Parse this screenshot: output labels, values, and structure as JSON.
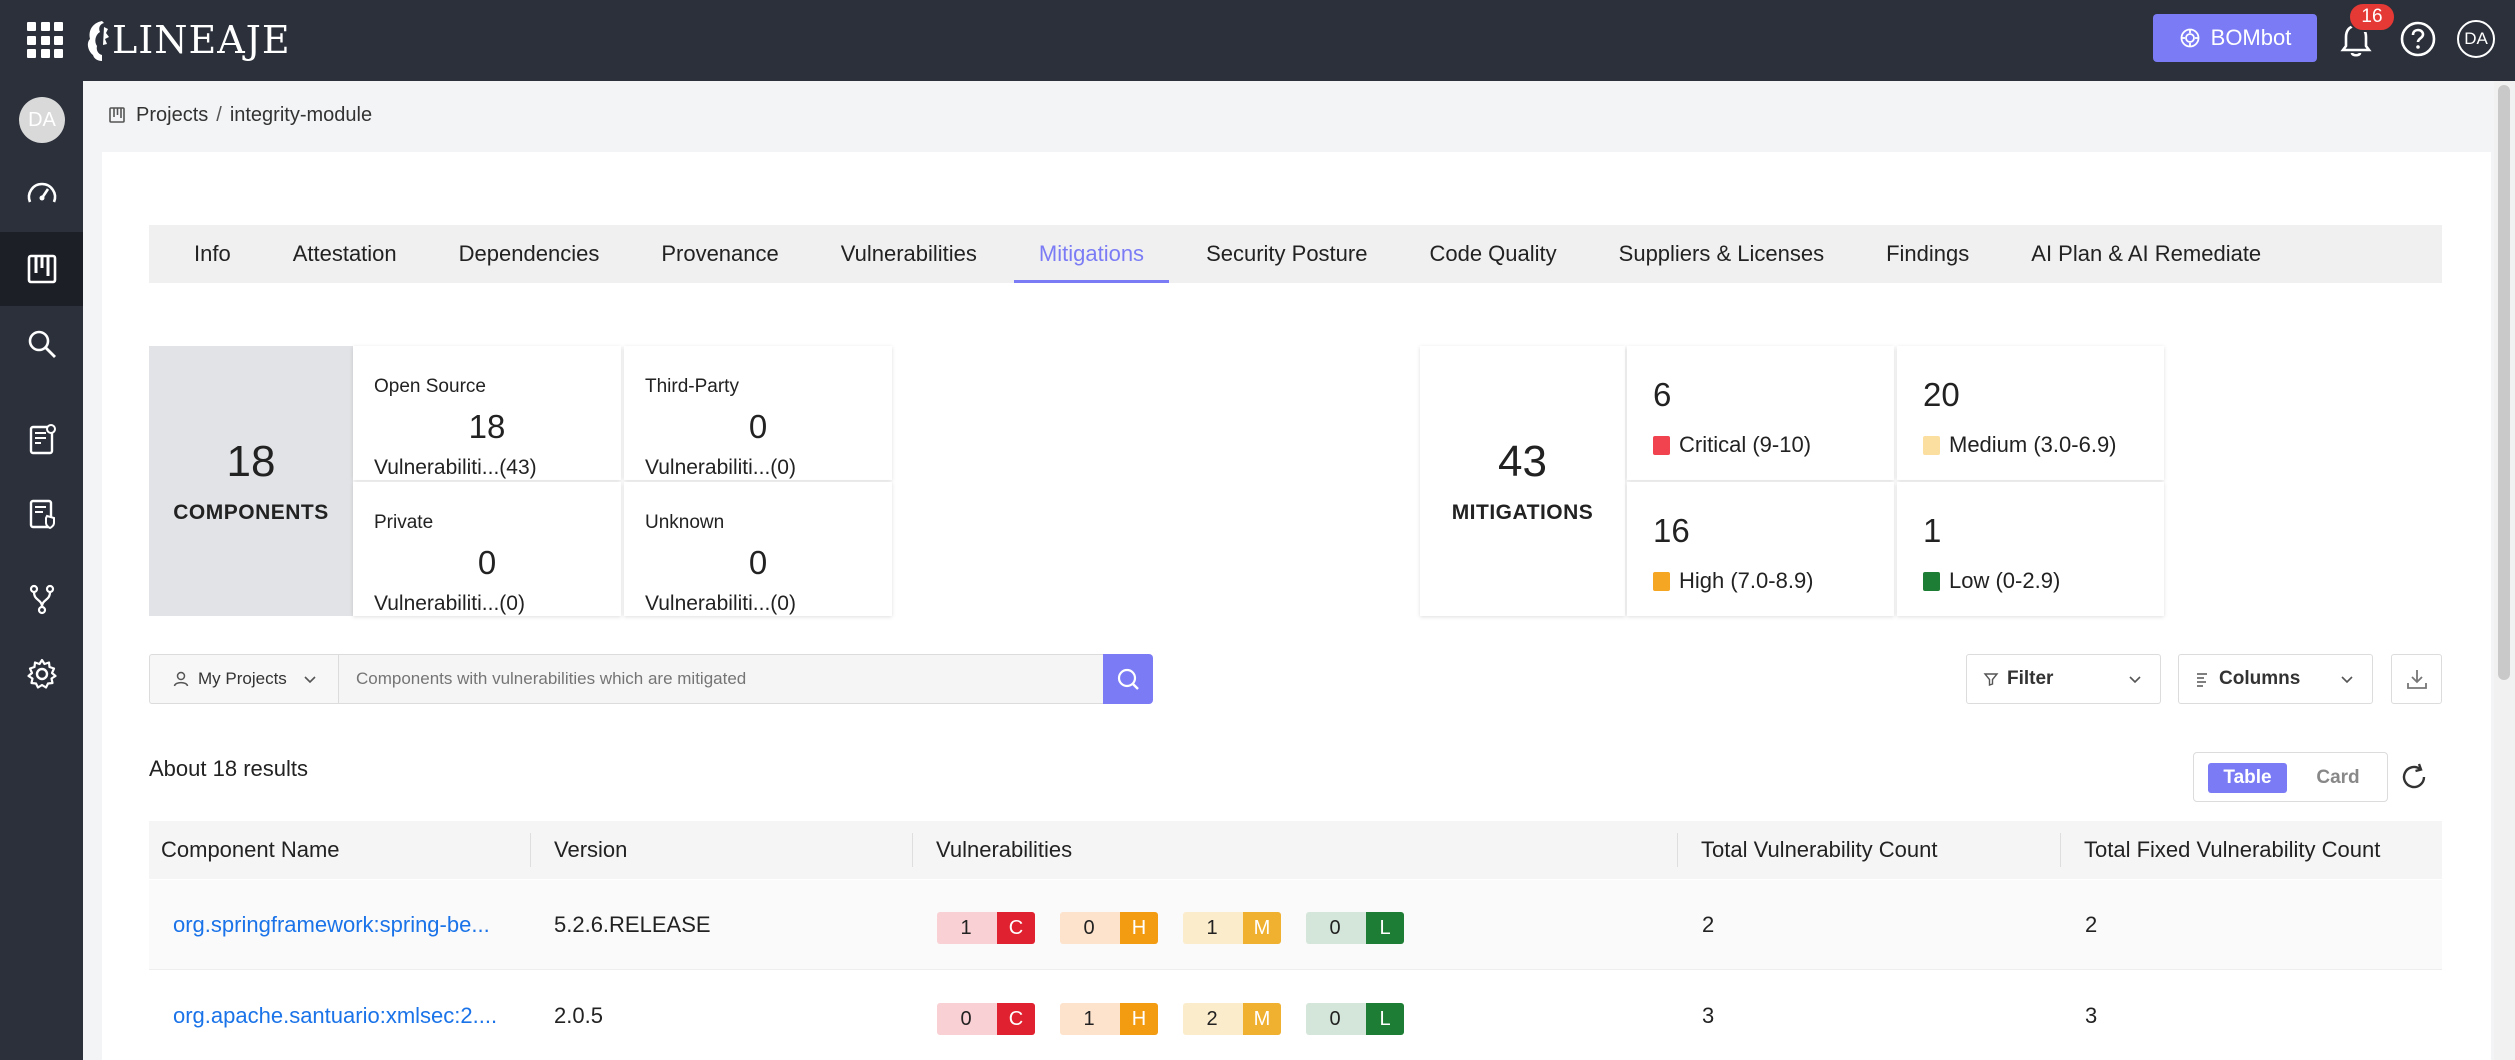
{
  "topbar": {
    "logo_text": "LINEAJE",
    "bombot_label": "BOMbot",
    "notification_count": "16",
    "user_initials": "DA"
  },
  "sidebar": {
    "avatar_initials": "DA",
    "items": [
      {
        "icon": "dashboard-gauge-icon"
      },
      {
        "icon": "projects-board-icon",
        "active": true
      },
      {
        "icon": "search-icon"
      },
      {
        "icon": "report-icon"
      },
      {
        "icon": "policy-document-icon"
      },
      {
        "icon": "git-branch-icon"
      },
      {
        "icon": "gear-icon"
      }
    ]
  },
  "breadcrumb": {
    "root": "Projects",
    "separator": "/",
    "current": "integrity-module"
  },
  "tabs": [
    {
      "label": "Info"
    },
    {
      "label": "Attestation"
    },
    {
      "label": "Dependencies"
    },
    {
      "label": "Provenance"
    },
    {
      "label": "Vulnerabilities"
    },
    {
      "label": "Mitigations",
      "active": true
    },
    {
      "label": "Security Posture"
    },
    {
      "label": "Code Quality"
    },
    {
      "label": "Suppliers & Licenses"
    },
    {
      "label": "Findings"
    },
    {
      "label": "AI Plan & AI Remediate"
    }
  ],
  "components": {
    "total": "18",
    "label": "COMPONENTS",
    "cards": [
      {
        "title": "Open Source",
        "count": "18",
        "vuln": "Vulnerabiliti...(43)"
      },
      {
        "title": "Third-Party",
        "count": "0",
        "vuln": "Vulnerabiliti...(0)"
      },
      {
        "title": "Private",
        "count": "0",
        "vuln": "Vulnerabiliti...(0)"
      },
      {
        "title": "Unknown",
        "count": "0",
        "vuln": "Vulnerabiliti...(0)"
      }
    ]
  },
  "mitigations": {
    "total": "43",
    "label": "MITIGATIONS",
    "severity": [
      {
        "count": "6",
        "label": "Critical (9-10)",
        "color": "#f0434f"
      },
      {
        "count": "20",
        "label": "Medium (3.0-6.9)",
        "color": "#fbdfa1"
      },
      {
        "count": "16",
        "label": "High (7.0-8.9)",
        "color": "#f5a623"
      },
      {
        "count": "1",
        "label": "Low (0-2.9)",
        "color": "#1e7d34"
      }
    ]
  },
  "search": {
    "project_scope": "My Projects",
    "placeholder": "Components with vulnerabilities which are mitigated",
    "filter_label": "Filter",
    "columns_label": "Columns"
  },
  "results": {
    "summary": "About 18 results",
    "view_table": "Table",
    "view_card": "Card"
  },
  "table": {
    "headers": [
      "Component Name",
      "Version",
      "Vulnerabilities",
      "Total Vulnerability Count",
      "Total Fixed Vulnerability Count"
    ],
    "severity_letters": [
      "C",
      "H",
      "M",
      "L"
    ],
    "rows": [
      {
        "name": "org.springframework:spring-be...",
        "version": "5.2.6.RELEASE",
        "vulns": [
          "1",
          "0",
          "1",
          "0"
        ],
        "total": "2",
        "fixed": "2"
      },
      {
        "name": "org.apache.santuario:xmlsec:2....",
        "version": "2.0.5",
        "vulns": [
          "0",
          "1",
          "2",
          "0"
        ],
        "total": "3",
        "fixed": "3"
      }
    ]
  },
  "colors": {
    "accent": "#7b7cf5",
    "topbar": "#2b303b",
    "link": "#1a73e8",
    "critical": "#e0212f",
    "high": "#f39c12",
    "medium": "#f0b030",
    "low": "#1e7d34"
  }
}
